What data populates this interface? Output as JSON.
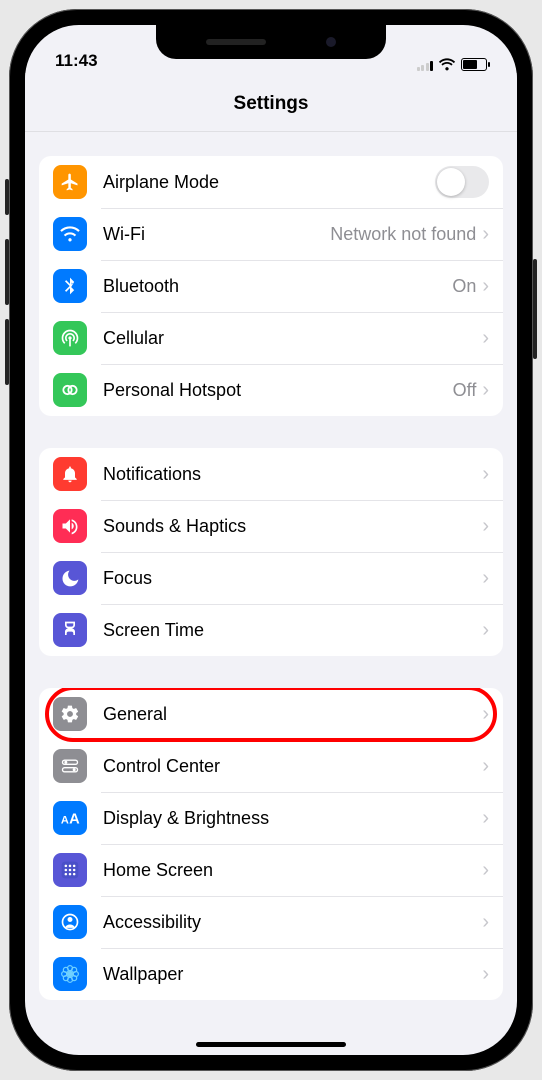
{
  "status": {
    "time": "11:43"
  },
  "header": {
    "title": "Settings"
  },
  "groups": [
    {
      "id": "connectivity",
      "rows": [
        {
          "id": "airplane",
          "icon": "airplane-icon",
          "color": "bg-orange",
          "label": "Airplane Mode",
          "control": "toggle",
          "toggle_on": false
        },
        {
          "id": "wifi",
          "icon": "wifi-icon",
          "color": "bg-blue",
          "label": "Wi-Fi",
          "value": "Network not found",
          "control": "chevron"
        },
        {
          "id": "bluetooth",
          "icon": "bluetooth-icon",
          "color": "bg-blue",
          "label": "Bluetooth",
          "value": "On",
          "control": "chevron"
        },
        {
          "id": "cellular",
          "icon": "antenna-icon",
          "color": "bg-green",
          "label": "Cellular",
          "control": "chevron"
        },
        {
          "id": "hotspot",
          "icon": "hotspot-icon",
          "color": "bg-green",
          "label": "Personal Hotspot",
          "value": "Off",
          "control": "chevron"
        }
      ]
    },
    {
      "id": "attention",
      "rows": [
        {
          "id": "notifications",
          "icon": "bell-icon",
          "color": "bg-red",
          "label": "Notifications",
          "control": "chevron"
        },
        {
          "id": "sounds",
          "icon": "speaker-icon",
          "color": "bg-pink",
          "label": "Sounds & Haptics",
          "control": "chevron"
        },
        {
          "id": "focus",
          "icon": "moon-icon",
          "color": "bg-indigo",
          "label": "Focus",
          "control": "chevron"
        },
        {
          "id": "screentime",
          "icon": "hourglass-icon",
          "color": "bg-indigo",
          "label": "Screen Time",
          "control": "chevron"
        }
      ]
    },
    {
      "id": "system",
      "rows": [
        {
          "id": "general",
          "icon": "gear-icon",
          "color": "bg-gray",
          "label": "General",
          "control": "chevron",
          "highlighted": true
        },
        {
          "id": "controlcenter",
          "icon": "switches-icon",
          "color": "bg-gray",
          "label": "Control Center",
          "control": "chevron"
        },
        {
          "id": "display",
          "icon": "textsize-icon",
          "color": "bg-blue",
          "label": "Display & Brightness",
          "control": "chevron"
        },
        {
          "id": "homescreen",
          "icon": "grid-icon",
          "color": "bg-indigo",
          "label": "Home Screen",
          "control": "chevron"
        },
        {
          "id": "accessibility",
          "icon": "person-icon",
          "color": "bg-blue",
          "label": "Accessibility",
          "control": "chevron"
        },
        {
          "id": "wallpaper",
          "icon": "flower-icon",
          "color": "bg-blue",
          "label": "Wallpaper",
          "control": "chevron"
        }
      ]
    }
  ]
}
